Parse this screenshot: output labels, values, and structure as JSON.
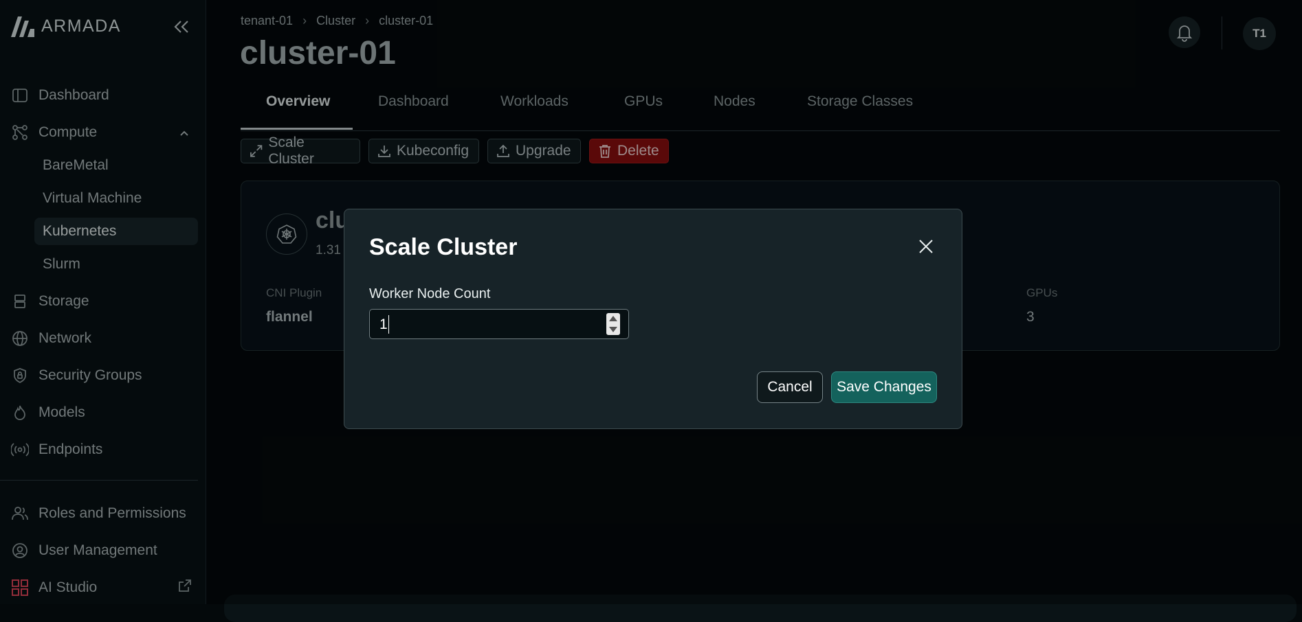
{
  "brand": {
    "name": "ARMADA"
  },
  "sidebar": {
    "items": [
      {
        "label": "Dashboard",
        "icon": "dashboard-icon"
      },
      {
        "label": "Compute",
        "icon": "compute-icon",
        "expanded": true,
        "children": [
          "BareMetal",
          "Virtual Machine",
          "Kubernetes",
          "Slurm"
        ],
        "active_child": "Kubernetes"
      },
      {
        "label": "Storage",
        "icon": "storage-icon"
      },
      {
        "label": "Network",
        "icon": "globe-icon"
      },
      {
        "label": "Security Groups",
        "icon": "shield-icon"
      },
      {
        "label": "Models",
        "icon": "flame-icon"
      },
      {
        "label": "Endpoints",
        "icon": "broadcast-icon"
      },
      {
        "label": "Roles and Permissions",
        "icon": "users-icon"
      },
      {
        "label": "User Management",
        "icon": "user-settings-icon"
      },
      {
        "label": "AI Studio",
        "icon": "grid-icon"
      }
    ]
  },
  "breadcrumb": [
    "tenant-01",
    "Cluster",
    "cluster-01"
  ],
  "page": {
    "title": "cluster-01"
  },
  "header": {
    "avatar_initials": "T1"
  },
  "tabs": [
    "Overview",
    "Dashboard",
    "Workloads",
    "GPUs",
    "Nodes",
    "Storage Classes"
  ],
  "active_tab": "Overview",
  "actions": {
    "scale": "Scale Cluster",
    "kubeconfig": "Kubeconfig",
    "upgrade": "Upgrade",
    "delete": "Delete"
  },
  "card": {
    "name_visible": "clu",
    "version_visible": "1.31",
    "cni_label": "CNI Plugin",
    "cni_value": "flannel",
    "gpus_label": "GPUs",
    "gpus_value": "3"
  },
  "modal": {
    "title": "Scale Cluster",
    "field_label": "Worker Node Count",
    "field_value": "1",
    "cancel": "Cancel",
    "save": "Save Changes"
  },
  "colors": {
    "accent": "#14625c",
    "danger": "#8a0f0f",
    "background": "#04090b"
  }
}
